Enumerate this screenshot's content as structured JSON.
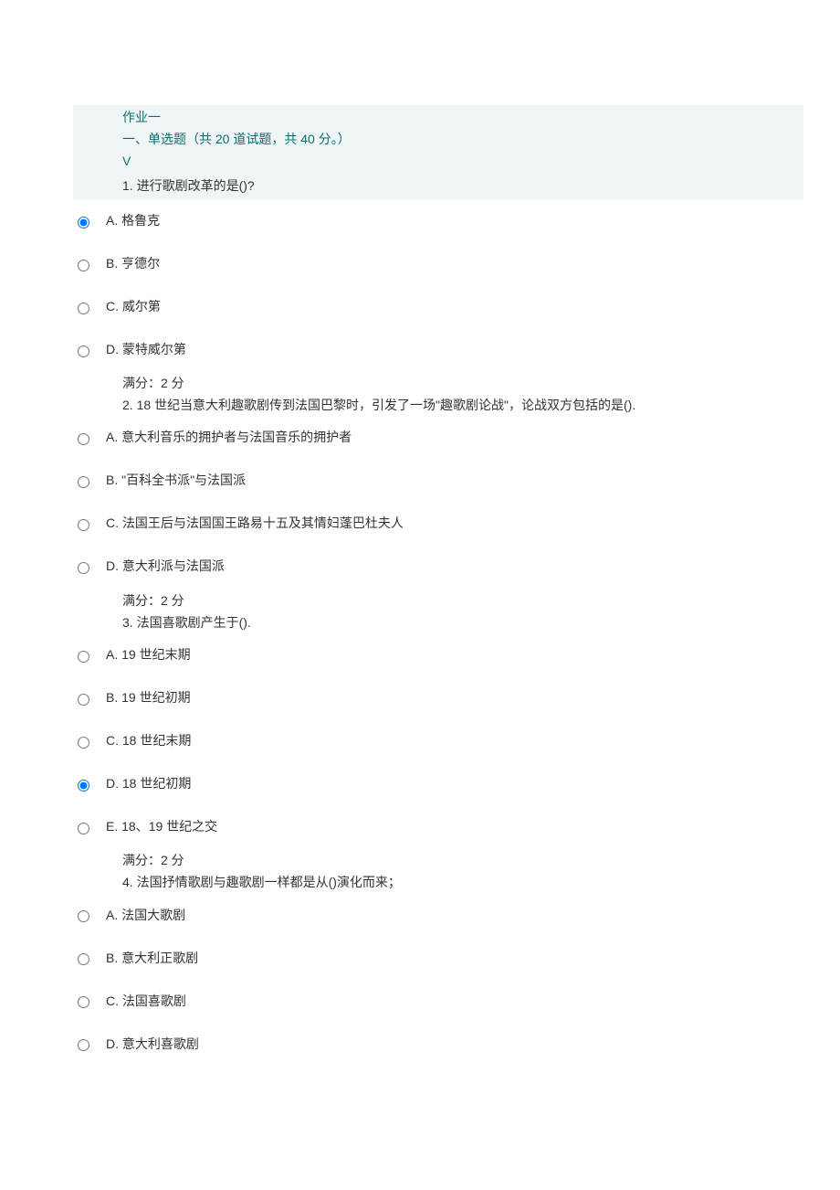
{
  "header": {
    "title": "作业一",
    "sub": "一、单选题（共 20 道试题，共 40 分。）",
    "marker": "V"
  },
  "score_text": "满分：2 分",
  "questions": [
    {
      "text": "1.  进行歌剧改革的是()?",
      "selected": 0,
      "options": [
        "A. 格鲁克",
        "B. 亨德尔",
        "C. 威尔第",
        "D. 蒙特威尔第"
      ]
    },
    {
      "text": "2. 18 世纪当意大利趣歌剧传到法国巴黎时，引发了一场\"趣歌剧论战\"，论战双方包括的是().",
      "selected": -1,
      "options": [
        "A. 意大利音乐的拥护者与法国音乐的拥护者",
        "B. \"百科全书派\"与法国派",
        "C. 法国王后与法国国王路易十五及其情妇蓬巴杜夫人",
        "D. 意大利派与法国派"
      ]
    },
    {
      "text": "3.  法国喜歌剧产生于().",
      "selected": 3,
      "options": [
        "A. 19 世纪末期",
        "B. 19 世纪初期",
        "C. 18 世纪末期",
        "D. 18 世纪初期",
        "E. 18、19 世纪之交"
      ]
    },
    {
      "text": "4.  法国抒情歌剧与趣歌剧一样都是从()演化而来；",
      "selected": -1,
      "options": [
        "A. 法国大歌剧",
        "B. 意大利正歌剧",
        "C. 法国喜歌剧",
        "D. 意大利喜歌剧"
      ]
    }
  ]
}
